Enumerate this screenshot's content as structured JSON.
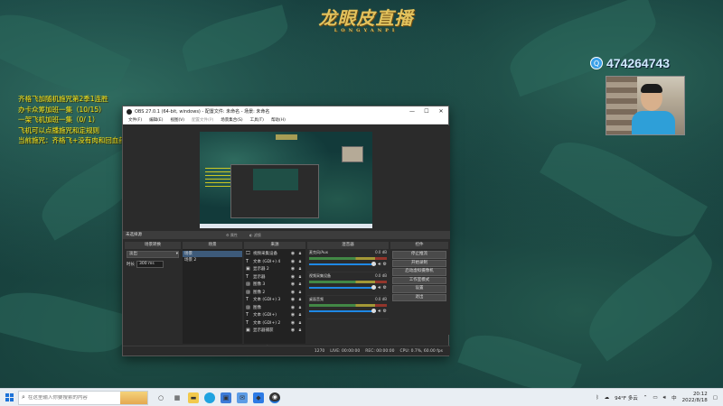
{
  "overlay": {
    "logo_text": "龙眼皮直播",
    "logo_sub": "LONGYANPI",
    "qq_number": "474264743",
    "notes": [
      "齐格飞加随机施咒第2季1连胜",
      "办卡众筹加班一集（10/15）",
      "一架飞机加班一集（0/ 1）",
      "飞机可以点播施咒和定规则",
      "当前施咒：齐格飞+没有肉和回血药"
    ]
  },
  "obs": {
    "title": "OBS 27.0.1 (64-bit, windows) - 配置文件: 未命名 - 场景: 未命名",
    "window_controls": [
      "—",
      "☐",
      "✕"
    ],
    "menu": [
      "文件(F)",
      "编辑(E)",
      "视图(V)",
      "配置文件(P)",
      "场景集合(S)",
      "工具(T)",
      "帮助(H)"
    ],
    "scene_toolbar": {
      "no_source": "未选择源",
      "properties": "属性",
      "filters": "滤镜"
    },
    "docks": {
      "transitions": "场景转换",
      "scenes": "场景",
      "sources": "来源",
      "mixer": "混音器",
      "controls": "控件"
    },
    "transition": {
      "selected": "淡出",
      "duration_label": "时长",
      "duration_value": "300 ms"
    },
    "scenes": [
      "场景",
      "场景 2"
    ],
    "sources": [
      {
        "icon": "🖵",
        "label": "视频采集设备"
      },
      {
        "icon": "T",
        "label": "文本 (GDI+) 4"
      },
      {
        "icon": "▣",
        "label": "显示器 2"
      },
      {
        "icon": "T",
        "label": "显示器"
      },
      {
        "icon": "▨",
        "label": "图像 3"
      },
      {
        "icon": "▨",
        "label": "图像 2"
      },
      {
        "icon": "T",
        "label": "文本 (GDI+) 3"
      },
      {
        "icon": "▨",
        "label": "图像"
      },
      {
        "icon": "T",
        "label": "文本 (GDI+)"
      },
      {
        "icon": "T",
        "label": "文本 (GDI+) 2"
      },
      {
        "icon": "▣",
        "label": "显示器捕获"
      }
    ],
    "mixer": [
      {
        "name": "麦克风/Aux",
        "db": "0.0 dB"
      },
      {
        "name": "视频采集设备",
        "db": "0.0 dB"
      },
      {
        "name": "桌面音频",
        "db": "0.0 dB"
      }
    ],
    "controls": [
      "停止推流",
      "开始录制",
      "启动虚拟摄像机",
      "工作室模式",
      "设置",
      "退出"
    ],
    "footer_buttons": [
      "+",
      "−",
      "∧",
      "∨"
    ],
    "status": {
      "live": "LIVE: 00:00:00",
      "rec": "REC: 00:00:00",
      "cpu": "CPU: 0.7%, 60.00 fps",
      "kbps": "1270"
    }
  },
  "taskbar": {
    "search_placeholder": "在这里输入你要搜索的内容",
    "weather": "94°F 多云",
    "time": "20:12",
    "date": "2022/8/18"
  }
}
